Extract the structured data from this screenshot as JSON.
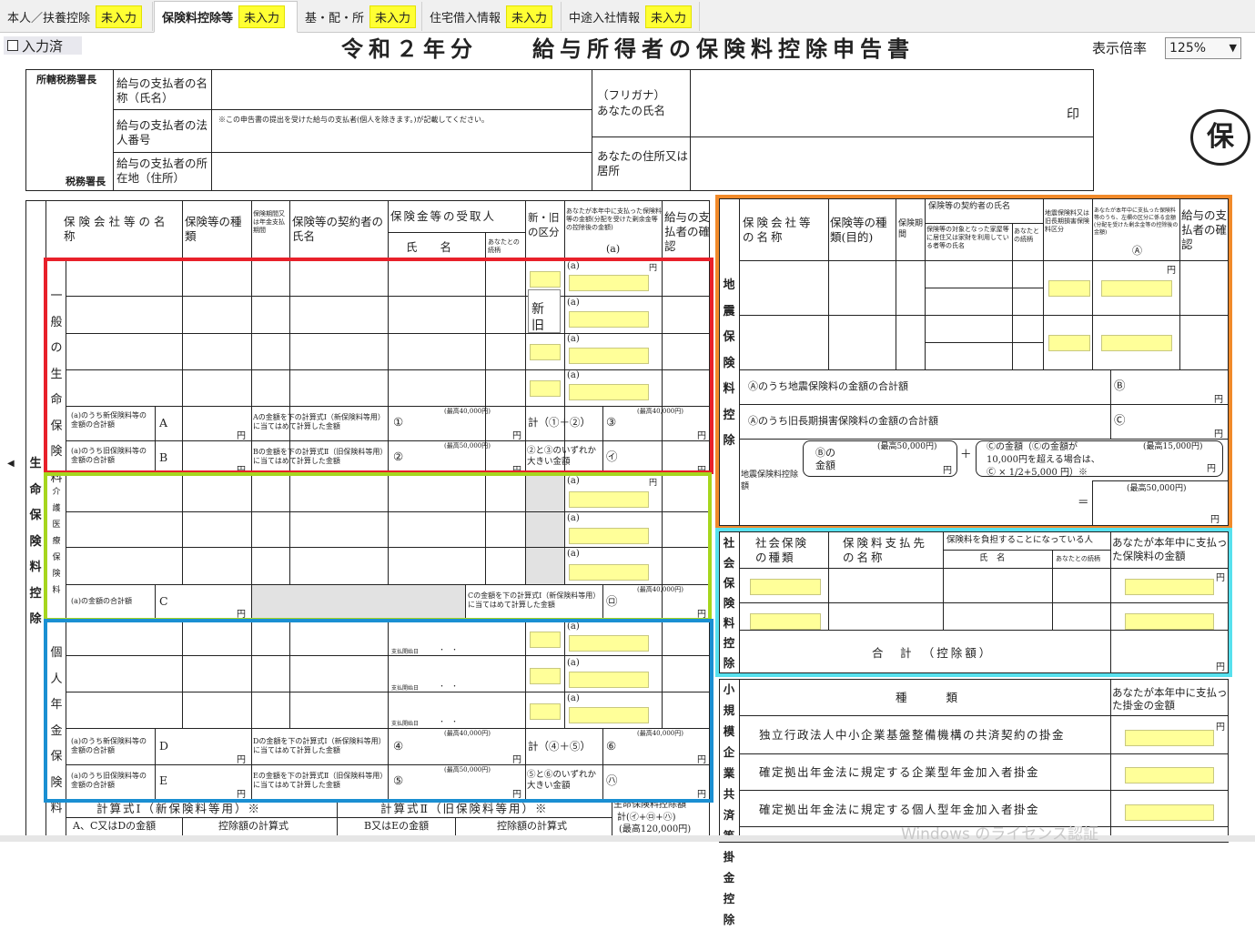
{
  "tabs": [
    {
      "label": "本人／扶養控除",
      "status": "未入力",
      "active": false
    },
    {
      "label": "保険料控除等",
      "status": "未入力",
      "active": true
    },
    {
      "label": "基・配・所",
      "status": "未入力",
      "active": false
    },
    {
      "label": "住宅借入情報",
      "status": "未入力",
      "active": false
    },
    {
      "label": "中途入社情報",
      "status": "未入力",
      "active": false
    }
  ],
  "header": {
    "done_checkbox_label": "入力済",
    "title": "令和２年分　　給与所得者の保険料控除申告書",
    "zoom_label": "表示倍率",
    "zoom_value": "125%"
  },
  "top_section": {
    "tax_office_label": "所轄税務署長",
    "tax_office_suffix": "税務署長",
    "payer_name_label": "給与の支払者の名称（氏名）",
    "payer_number_label": "給与の支払者の法人番号",
    "payer_number_note": "※この申告書の提出を受けた給与の支払者(個人を除きます。)が記載してください。",
    "payer_address_label": "給与の支払者の所在地（住所）",
    "furigana_label": "（フリガナ）",
    "your_name_label": "あなたの氏名",
    "seal": "印",
    "your_address_label": "あなたの住所又は居所",
    "stamp": "保"
  },
  "life": {
    "section_label": "生命保険料控除",
    "col_company": "保険会社等の名称",
    "col_type": "保険等の種類",
    "col_period": "保険期間又は年金支払期間",
    "col_contractor": "保険等の契約者の氏名",
    "col_recipient": "保険金等の受取人",
    "col_name": "氏　　名",
    "col_relation": "あなたとの続柄",
    "col_newold": "新・旧の区分",
    "col_amount": "あなたが本年中に支払った保険料等の金額(分配を受けた剰余金等の控除後の金額)",
    "col_amount_mark": "(a)",
    "col_confirm": "給与の支払者の確認",
    "general_label": "一般の生命保険料",
    "nursing_label": "介護医療保険料",
    "pension_label": "個人年金保険料",
    "newold_popup": [
      "新",
      "旧"
    ],
    "a_mark": "(a)",
    "yen": "円",
    "sum_A_label": "(a)のうち新保険料等の金額の合計額",
    "sum_A_mark": "A",
    "calc_A_text": "Aの金額を下の計算式Ⅰ（新保険料等用）に当てはめて計算した金額",
    "calc_A_mark": "①",
    "max_40000": "(最高40,000円)",
    "max_50000": "(最高50,000円)",
    "total_12": "計（①＋②）",
    "mark_3": "③",
    "sum_B_label": "(a)のうち旧保険料等の金額の合計額",
    "sum_B_mark": "B",
    "calc_B_text": "Bの金額を下の計算式Ⅱ（旧保険料等用）に当てはめて計算した金額",
    "calc_B_mark": "②",
    "larger_23": "②と③のいずれか大きい金額",
    "mark_i": "㋑",
    "sum_C_label": "(a)の金額の合計額",
    "sum_C_mark": "C",
    "calc_C_text": "Cの金額を下の計算式Ⅰ（新保険料等用）に当てはめて計算した金額",
    "mark_ro": "㋺",
    "pension_start": "支払開始日",
    "pension_start_dots": "・　・",
    "sum_D_label": "(a)のうち新保険料等の金額の合計額",
    "sum_D_mark": "D",
    "calc_D_text": "Dの金額を下の計算式Ⅰ（新保険料等用）に当てはめて計算した金額",
    "calc_D_mark": "④",
    "total_45": "計（④＋⑤）",
    "mark_6": "⑥",
    "sum_E_label": "(a)のうち旧保険料等の金額の合計額",
    "sum_E_mark": "E",
    "calc_E_text": "Eの金額を下の計算式Ⅱ（旧保険料等用）に当てはめて計算した金額",
    "calc_E_mark": "⑤",
    "larger_56": "⑤と⑥のいずれか大きい金額",
    "mark_ha": "㋩",
    "formula1": "計算式Ⅰ（新保険料等用）※",
    "formula2": "計算式Ⅱ（旧保険料等用）※",
    "formula_acd": "A、C又はDの金額",
    "formula_be": "B又はEの金額",
    "formula_calc": "控除額の計算式",
    "life_total": "生命保険料控除額",
    "life_total_calc": "計(㋑+㋺+㋩)",
    "life_total_max": "(最高120,000円)"
  },
  "earthquake": {
    "section_label": "地震保険料控除",
    "col_company": "保険会社等の名称",
    "col_type": "保険等の種類(目的)",
    "col_period": "保険期間",
    "col_contractor": "保険等の契約者の氏名",
    "col_residence": "保険等の対象となった家屋等に居住又は家財を利用している者等の氏名",
    "col_relation": "あなたとの続柄",
    "col_kind": "地震保険料又は旧長期損害保険料区分",
    "col_amount": "あなたが本年中に支払った保険料等のうち、左欄の区分に係る金額(分配を受けた剰余金等の控除後の金額)",
    "col_amount_mark": "Ⓐ",
    "col_confirm": "給与の支払者の確認",
    "sum_eq": "Ⓐのうち地震保険料の金額の合計額",
    "sum_eq_mark": "Ⓑ",
    "sum_old": "Ⓐのうち旧長期損害保険料の金額の合計額",
    "sum_old_mark": "Ⓒ",
    "deduction_label": "地震保険料控除額",
    "b_amount": "Ⓑの金額",
    "max_50000": "(最高50,000円)",
    "max_15000": "(最高15,000円)",
    "c_formula_1": "Ⓒの金額（Ⓒの金額が",
    "c_formula_2": "10,000円を超える場合は、",
    "c_formula_3": "Ⓒ × 1/2+5,000 円）※",
    "plus": "＋",
    "equals": "＝",
    "yen": "円"
  },
  "social": {
    "section_label": "社会保険料控除",
    "col_type": "社会保険の種類",
    "col_payee": "保険料支払先の名称",
    "col_bearer": "保険料を負担することになっている人",
    "col_name": "氏　名",
    "col_relation": "あなたとの続柄",
    "col_amount": "あなたが本年中に支払った保険料の金額",
    "total": "合　計　（控除額）",
    "yen": "円"
  },
  "small": {
    "section_label": "小規模企業共済等掛金控除",
    "col_kind": "種　　類",
    "col_amount": "あなたが本年中に支払った掛金の金額",
    "row1": "独立行政法人中小企業基盤整備機構の共済契約の掛金",
    "row2": "確定拠出年金法に規定する企業型年金加入者掛金",
    "row3": "確定拠出年金法に規定する個人型年金加入者掛金",
    "yen": "円"
  },
  "watermark": "Windows のライセンス認証",
  "colors": {
    "red": "#e8202a",
    "green": "#a6d61e",
    "blue": "#1a8fd2",
    "orange": "#f18a2a",
    "cyan": "#57e1ee",
    "input_yellow": "#ffff99",
    "badge_yellow": "#ffff33"
  }
}
